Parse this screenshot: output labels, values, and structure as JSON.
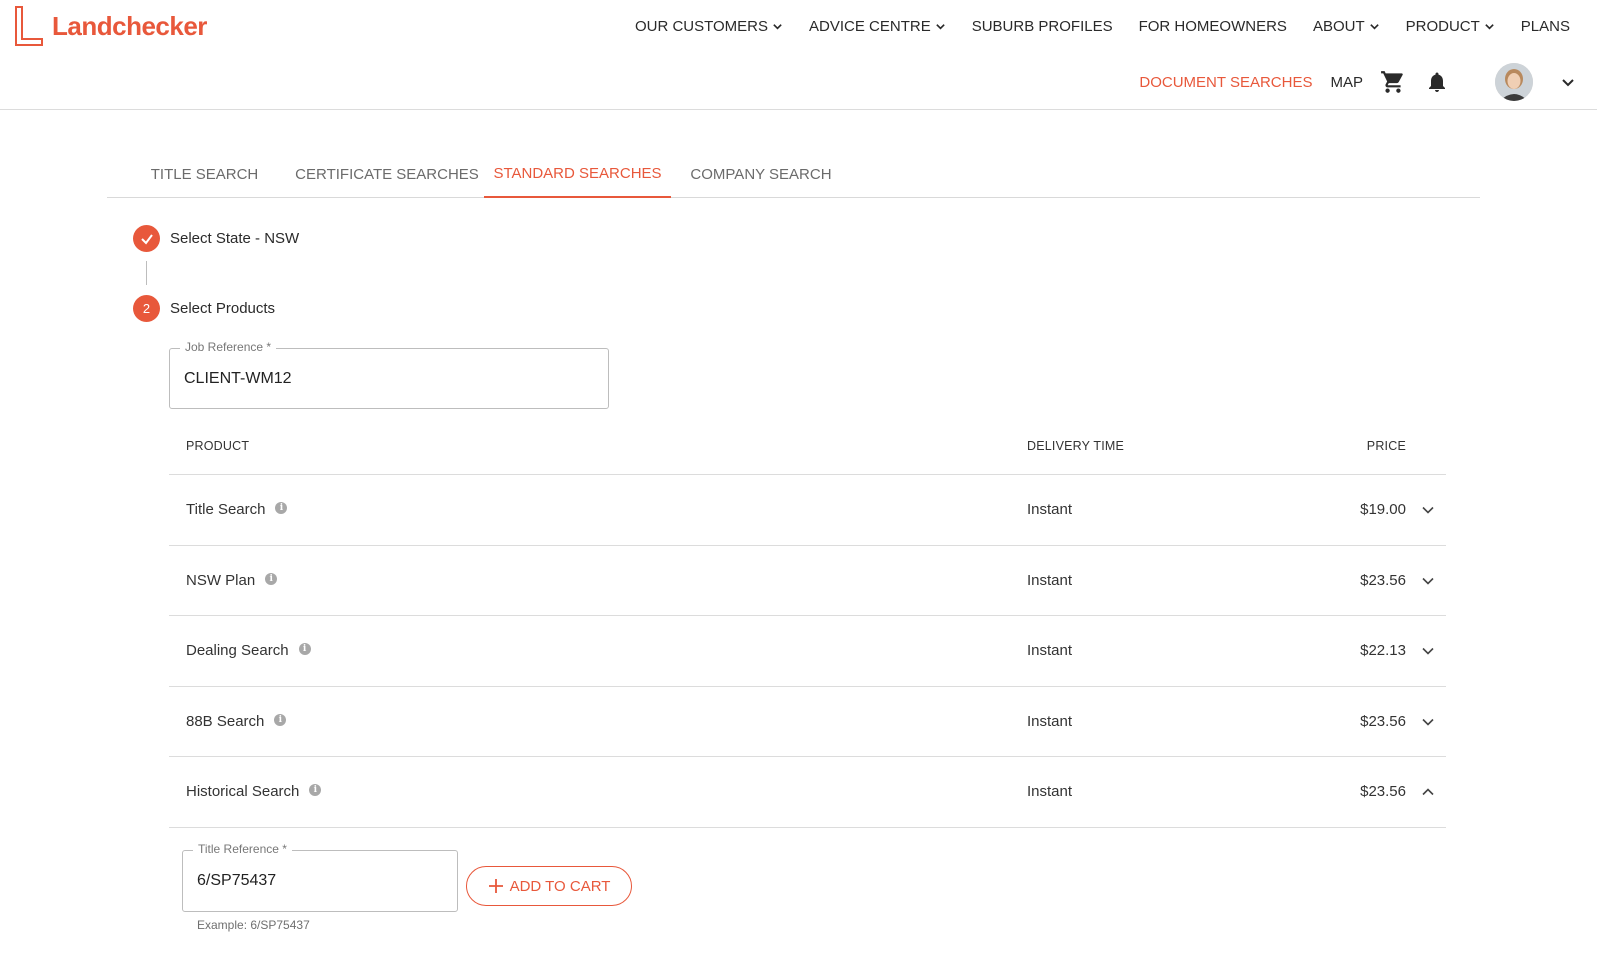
{
  "brand": {
    "name": "Landchecker",
    "color": "#e8583b"
  },
  "nav": {
    "top": [
      {
        "label": "OUR CUSTOMERS",
        "dropdown": true
      },
      {
        "label": "ADVICE CENTRE",
        "dropdown": true
      },
      {
        "label": "SUBURB PROFILES",
        "dropdown": false
      },
      {
        "label": "FOR HOMEOWNERS",
        "dropdown": false
      },
      {
        "label": "ABOUT",
        "dropdown": true
      },
      {
        "label": "PRODUCT",
        "dropdown": true
      },
      {
        "label": "PLANS",
        "dropdown": false
      }
    ],
    "secondary": {
      "document_searches": "DOCUMENT SEARCHES",
      "map": "MAP",
      "icons": [
        "cart-icon",
        "bell-icon",
        "avatar",
        "chevron-down-icon"
      ]
    }
  },
  "tabs": [
    {
      "label": "TITLE SEARCH",
      "active": false
    },
    {
      "label": "CERTIFICATE SEARCHES",
      "active": false
    },
    {
      "label": "STANDARD SEARCHES",
      "active": true
    },
    {
      "label": "COMPANY SEARCH",
      "active": false
    }
  ],
  "steps": [
    {
      "marker": "check",
      "label": "Select State - NSW"
    },
    {
      "marker": "2",
      "label": "Select Products"
    }
  ],
  "job_reference": {
    "label": "Job Reference *",
    "value": "CLIENT-WM12"
  },
  "table": {
    "headers": {
      "product": "PRODUCT",
      "delivery": "DELIVERY TIME",
      "price": "PRICE"
    },
    "rows": [
      {
        "product": "Title Search",
        "delivery": "Instant",
        "price": "$19.00",
        "expanded": false
      },
      {
        "product": "NSW Plan",
        "delivery": "Instant",
        "price": "$23.56",
        "expanded": false
      },
      {
        "product": "Dealing Search",
        "delivery": "Instant",
        "price": "$22.13",
        "expanded": false
      },
      {
        "product": "88B Search",
        "delivery": "Instant",
        "price": "$23.56",
        "expanded": false
      },
      {
        "product": "Historical Search",
        "delivery": "Instant",
        "price": "$23.56",
        "expanded": true
      }
    ]
  },
  "expanded_form": {
    "title_reference": {
      "label": "Title Reference *",
      "value": "6/SP75437"
    },
    "add_to_cart": "ADD TO CART",
    "helper": "Example: 6/SP75437"
  }
}
